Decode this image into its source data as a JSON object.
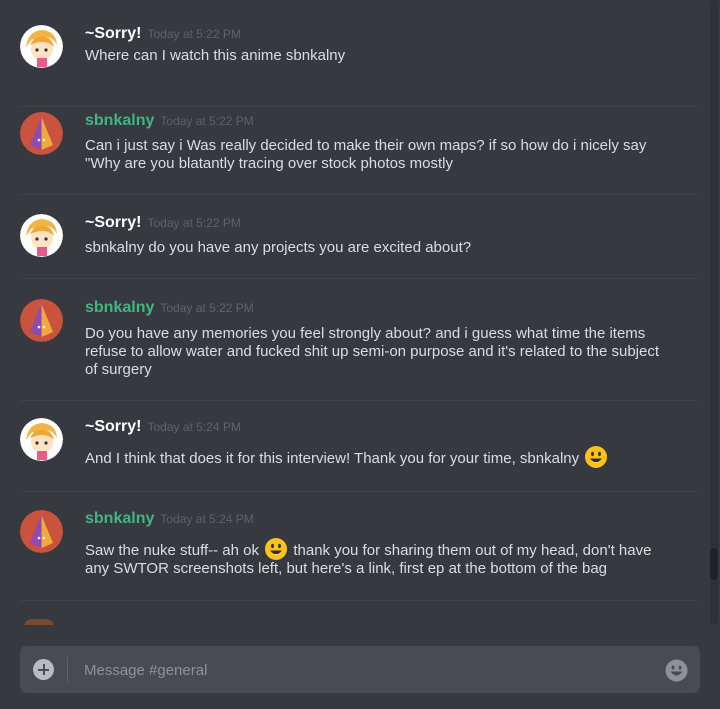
{
  "channel": {
    "input_placeholder": "Message #general"
  },
  "messages": [
    {
      "author": "~Sorry!",
      "time": "Today at 5:22 PM",
      "lines": [
        "Where can I watch this anime sbnkalny"
      ]
    },
    {
      "author": "sbnkalny",
      "time": "Today at 5:22 PM",
      "lines": [
        "Can i just say i Was really decided to make their own maps? if so how do i nicely say",
        "\"Why are you blatantly tracing over stock photos mostly"
      ]
    },
    {
      "author": "~Sorry!",
      "time": "Today at 5:22 PM",
      "lines": [
        "sbnkalny do you have any projects you are excited about?"
      ]
    },
    {
      "author": "sbnkalny",
      "time": "Today at 5:22 PM",
      "lines": [
        "Do you have any memories you feel strongly about? and i guess what time the items",
        "refuse to allow water and fucked shit up semi-on purpose and it's related to the subject",
        "of surgery"
      ]
    },
    {
      "author": "~Sorry!",
      "time": "Today at 5:24 PM",
      "text_before_emoji": "And I think that does it for this interview! Thank you for your time, sbnkalny"
    },
    {
      "author": "sbnkalny",
      "time": "Today at 5:24 PM",
      "line1_before_emoji": "Saw the nuke stuff-- ah ok",
      "line1_after_emoji": "thank you for sharing them out of my head, don't have",
      "line2": "any SWTOR screenshots left, but here's a link, first ep at the bottom of the bag"
    }
  ],
  "colors": {
    "background": "#36393f",
    "sorry_name": "#ffffff",
    "sbnkalny_name": "#43b581",
    "message_text": "#dcddde",
    "timestamp": "#5f6269",
    "composer": "#484b51"
  },
  "icons": {
    "attach": "plus-circle-icon",
    "emoji_picker": "smiley-icon",
    "inline_emoji": "smiley-emoji"
  }
}
